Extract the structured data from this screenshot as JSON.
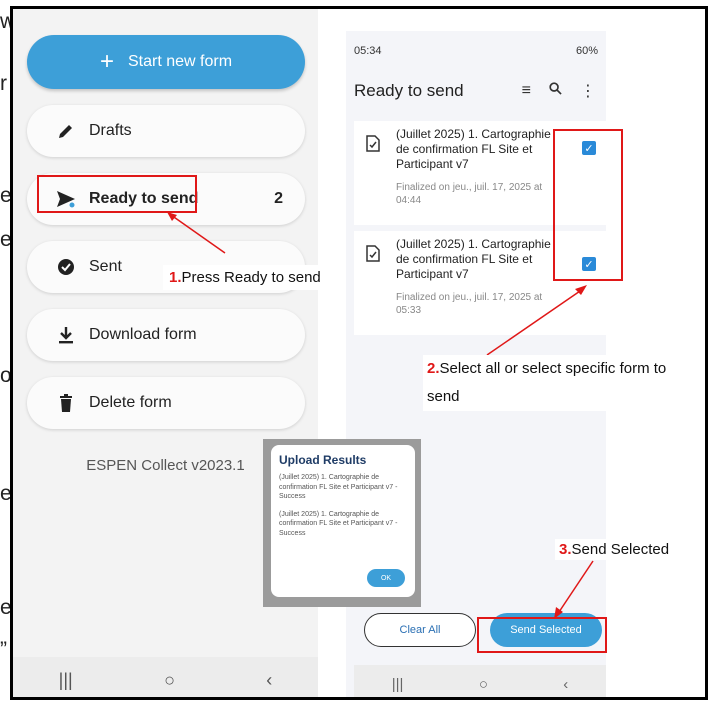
{
  "left_phone": {
    "start_button": "Start new form",
    "menu": [
      {
        "label": "Drafts",
        "count": ""
      },
      {
        "label": "Ready to send",
        "count": "2"
      },
      {
        "label": "Sent",
        "count": ""
      },
      {
        "label": "Download form",
        "count": ""
      },
      {
        "label": "Delete form",
        "count": ""
      }
    ],
    "version": "ESPEN Collect v2023.1"
  },
  "right_phone": {
    "time": "05:34",
    "battery": "60%",
    "title": "Ready to send",
    "forms": [
      {
        "title": "(Juillet 2025) 1. Cartographie de confirmation FL Site et Participant v7",
        "meta": "Finalized on jeu., juil. 17, 2025 at 04:44",
        "checked": true
      },
      {
        "title": "(Juillet 2025) 1. Cartographie de confirmation FL Site et Participant v7",
        "meta": "Finalized on jeu., juil. 17, 2025 at 05:33",
        "checked": true
      }
    ],
    "clear_all": "Clear All",
    "send_selected": "Send Selected"
  },
  "dialog": {
    "title": "Upload Results",
    "lines": [
      "(Juillet 2025) 1. Cartographie de confirmation FL Site et Participant v7 - Success",
      "(Juillet 2025) 1. Cartographie de confirmation FL Site et Participant v7 - Success"
    ],
    "ok": "OK"
  },
  "annotations": {
    "step1_num": "1.",
    "step1_text": "Press Ready to send",
    "step2_num": "2.",
    "step2_text": "Select all or select specific form to send",
    "step3_num": "3.",
    "step3_text": "Send Selected"
  },
  "edge_text": [
    "w",
    "r",
    "e",
    "e",
    "o",
    "e",
    "e",
    "”"
  ],
  "colors": {
    "accent": "#3d9fd8",
    "highlight": "#e01818"
  }
}
